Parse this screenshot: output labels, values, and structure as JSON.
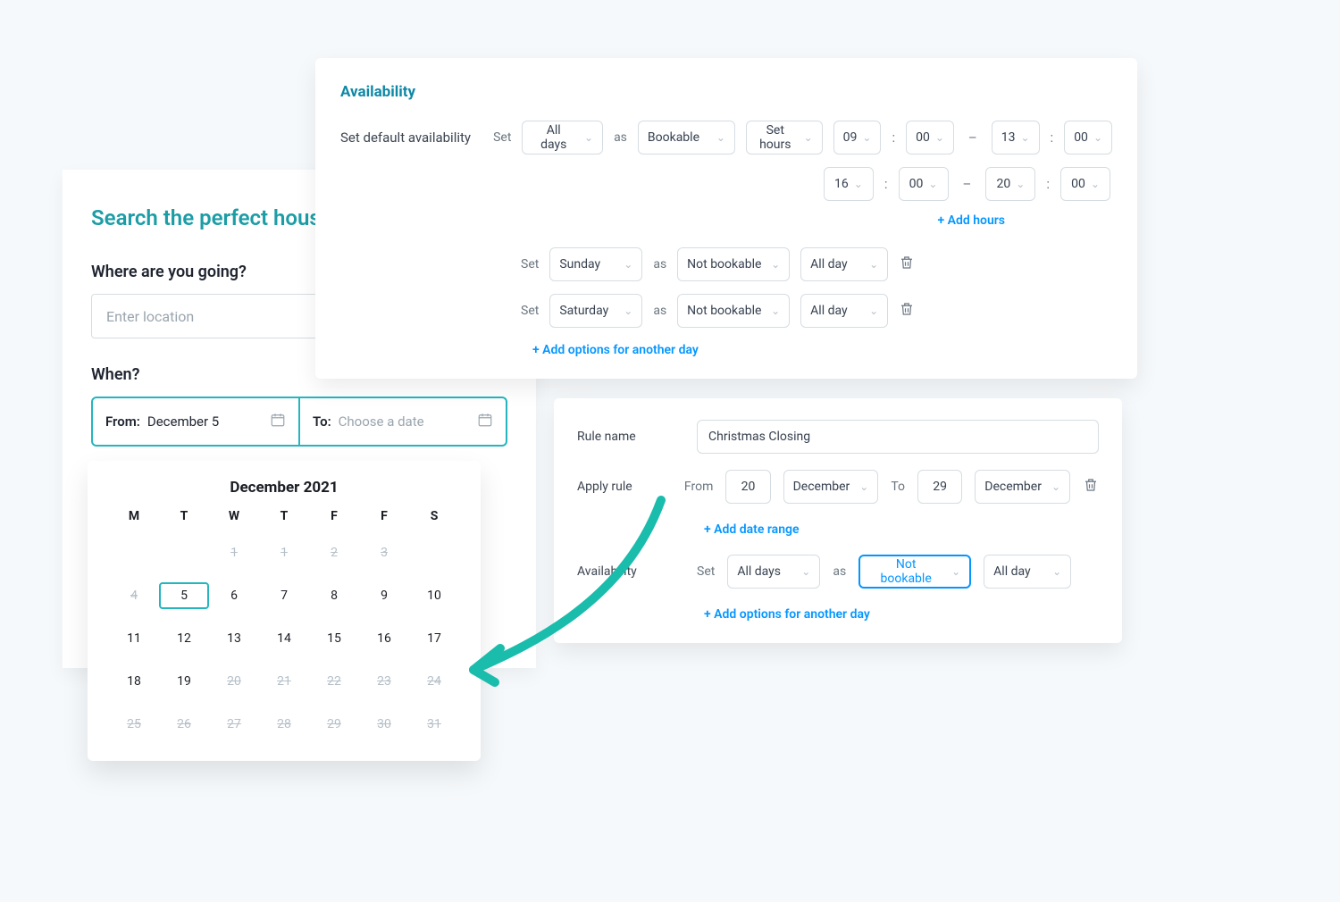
{
  "search": {
    "title": "Search the perfect house for your holidays",
    "where_label": "Where are you going?",
    "loc_placeholder": "Enter location",
    "when_label": "When?",
    "from_key": "From:",
    "from_value": "December 5",
    "to_key": "To:",
    "to_placeholder": "Choose a date"
  },
  "calendar": {
    "title": "December 2021",
    "dow": [
      "M",
      "T",
      "W",
      "T",
      "F",
      "F",
      "S"
    ],
    "days": [
      {
        "n": "",
        "dim": false
      },
      {
        "n": "",
        "dim": false
      },
      {
        "n": "1",
        "dim": true
      },
      {
        "n": "1",
        "dim": true
      },
      {
        "n": "2",
        "dim": true
      },
      {
        "n": "3",
        "dim": true
      },
      {
        "n": "",
        "dim": false
      },
      {
        "n": "4",
        "dim": true
      },
      {
        "n": "5",
        "dim": false,
        "sel": true
      },
      {
        "n": "6",
        "dim": false
      },
      {
        "n": "7",
        "dim": false
      },
      {
        "n": "8",
        "dim": false
      },
      {
        "n": "9",
        "dim": false
      },
      {
        "n": "10",
        "dim": false
      },
      {
        "n": "11",
        "dim": false
      },
      {
        "n": "12",
        "dim": false
      },
      {
        "n": "13",
        "dim": false
      },
      {
        "n": "14",
        "dim": false
      },
      {
        "n": "15",
        "dim": false
      },
      {
        "n": "16",
        "dim": false
      },
      {
        "n": "17",
        "dim": false
      },
      {
        "n": "18",
        "dim": false
      },
      {
        "n": "19",
        "dim": false
      },
      {
        "n": "20",
        "dim": true
      },
      {
        "n": "21",
        "dim": true
      },
      {
        "n": "22",
        "dim": true
      },
      {
        "n": "23",
        "dim": true
      },
      {
        "n": "24",
        "dim": true
      },
      {
        "n": "25",
        "dim": true
      },
      {
        "n": "26",
        "dim": true
      },
      {
        "n": "27",
        "dim": true
      },
      {
        "n": "28",
        "dim": true
      },
      {
        "n": "29",
        "dim": true
      },
      {
        "n": "30",
        "dim": true
      },
      {
        "n": "31",
        "dim": true
      }
    ]
  },
  "availability": {
    "title": "Availability",
    "set_default_label": "Set default availability",
    "set_word": "Set",
    "as_word": "as",
    "add_hours": "+ Add hours",
    "add_day_options": "+ Add options for another day",
    "row1": {
      "day": "All days",
      "book": "Bookable",
      "mode": "Set hours",
      "h1": "09",
      "m1": "00",
      "h2": "13",
      "m2": "00"
    },
    "row1b": {
      "h1": "16",
      "m1": "00",
      "h2": "20",
      "m2": "00"
    },
    "row2": {
      "day": "Sunday",
      "book": "Not bookable",
      "mode": "All day"
    },
    "row3": {
      "day": "Saturday",
      "book": "Not bookable",
      "mode": "All day"
    }
  },
  "rule": {
    "name_label": "Rule name",
    "name_value": "Christmas Closing",
    "apply_label": "Apply rule",
    "from_word": "From",
    "to_word": "To",
    "d1": "20",
    "m1": "December",
    "d2": "29",
    "m2": "December",
    "add_range": "+ Add date range",
    "avail_label": "Availability",
    "set_word": "Set",
    "as_word": "as",
    "day": "All days",
    "book": "Not bookable",
    "mode": "All day",
    "add_day": "+ Add options for another day"
  }
}
